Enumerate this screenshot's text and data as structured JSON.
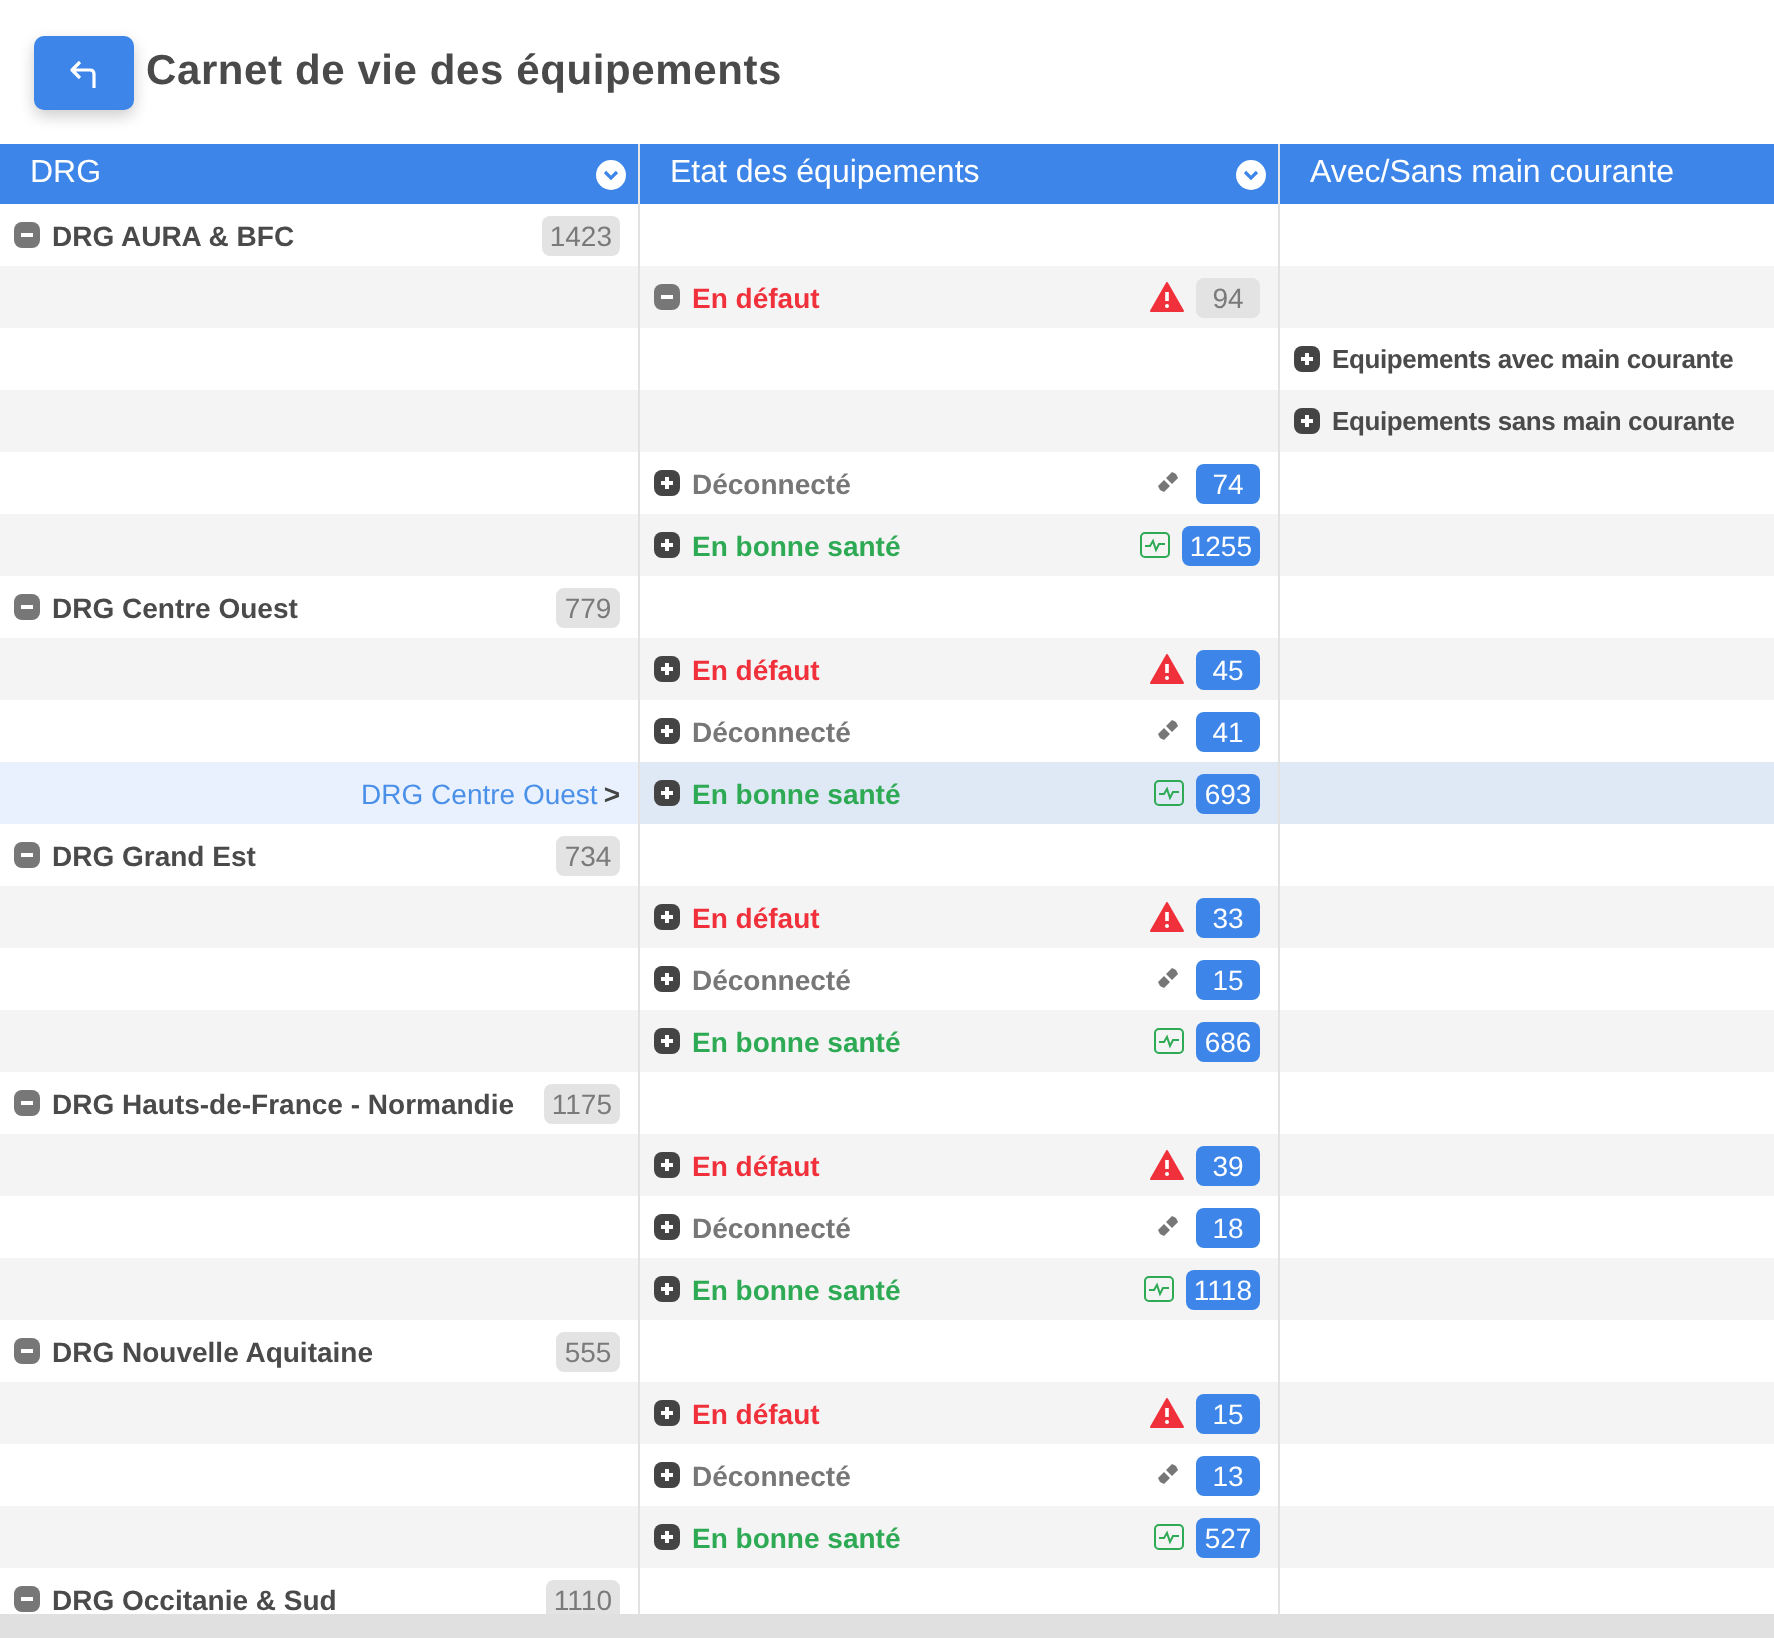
{
  "title": "Carnet de vie des équipements",
  "columns": [
    {
      "label": "DRG",
      "dropdown": true
    },
    {
      "label": "Etat des équipements",
      "dropdown": true
    },
    {
      "label": "Avec/Sans main courante",
      "dropdown": false
    }
  ],
  "rows": [
    {
      "kind": "group",
      "label": "DRG AURA & BFC",
      "count": "1423",
      "expanded": true,
      "selected": false
    },
    {
      "kind": "fault",
      "label": "En défaut",
      "count": "94",
      "expanded": true,
      "selected": false
    },
    {
      "kind": "sub",
      "label": "Equipements avec main courante",
      "expanded": false,
      "selected": false
    },
    {
      "kind": "sub",
      "label": "Equipements sans main courante",
      "expanded": false,
      "selected": false
    },
    {
      "kind": "disconnected",
      "label": "Déconnecté",
      "count": "74",
      "expanded": false,
      "selected": false
    },
    {
      "kind": "healthy",
      "label": "En bonne santé",
      "count": "1255",
      "expanded": false,
      "selected": false
    },
    {
      "kind": "group",
      "label": "DRG Centre Ouest",
      "count": "779",
      "expanded": true,
      "selected": false
    },
    {
      "kind": "fault",
      "label": "En défaut",
      "count": "45",
      "expanded": false,
      "selected": false
    },
    {
      "kind": "disconnected",
      "label": "Déconnecté",
      "count": "41",
      "expanded": false,
      "selected": false
    },
    {
      "kind": "healthy",
      "label": "En bonne santé",
      "count": "693",
      "expanded": false,
      "selected": true,
      "breadcrumb": "DRG Centre Ouest",
      "breadcrumb_sep": ">"
    },
    {
      "kind": "group",
      "label": "DRG Grand Est",
      "count": "734",
      "expanded": true,
      "selected": false
    },
    {
      "kind": "fault",
      "label": "En défaut",
      "count": "33",
      "expanded": false,
      "selected": false
    },
    {
      "kind": "disconnected",
      "label": "Déconnecté",
      "count": "15",
      "expanded": false,
      "selected": false
    },
    {
      "kind": "healthy",
      "label": "En bonne santé",
      "count": "686",
      "expanded": false,
      "selected": false
    },
    {
      "kind": "group",
      "label": "DRG Hauts-de-France - Normandie",
      "count": "1175",
      "expanded": true,
      "selected": false
    },
    {
      "kind": "fault",
      "label": "En défaut",
      "count": "39",
      "expanded": false,
      "selected": false
    },
    {
      "kind": "disconnected",
      "label": "Déconnecté",
      "count": "18",
      "expanded": false,
      "selected": false
    },
    {
      "kind": "healthy",
      "label": "En bonne santé",
      "count": "1118",
      "expanded": false,
      "selected": false
    },
    {
      "kind": "group",
      "label": "DRG Nouvelle Aquitaine",
      "count": "555",
      "expanded": true,
      "selected": false
    },
    {
      "kind": "fault",
      "label": "En défaut",
      "count": "15",
      "expanded": false,
      "selected": false
    },
    {
      "kind": "disconnected",
      "label": "Déconnecté",
      "count": "13",
      "expanded": false,
      "selected": false
    },
    {
      "kind": "healthy",
      "label": "En bonne santé",
      "count": "527",
      "expanded": false,
      "selected": false
    },
    {
      "kind": "group",
      "label": "DRG Occitanie & Sud",
      "count": "1110",
      "expanded": true,
      "selected": false
    }
  ]
}
